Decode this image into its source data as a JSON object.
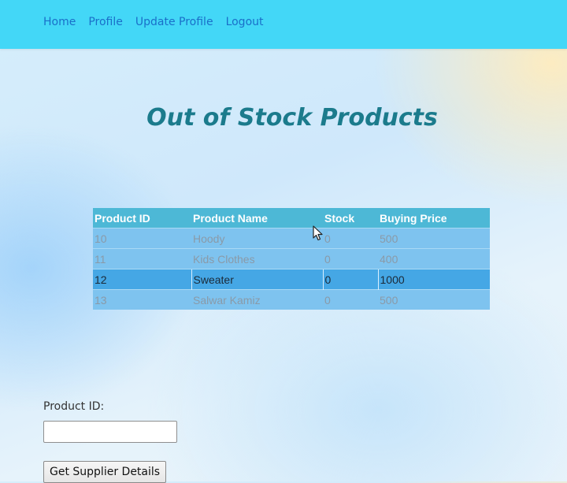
{
  "nav": {
    "links": [
      "Home",
      "Profile",
      "Update Profile",
      "Logout"
    ]
  },
  "page": {
    "title": "Out of Stock Products"
  },
  "table": {
    "headers": [
      "Product ID",
      "Product Name",
      "Stock",
      "Buying Price"
    ],
    "rows": [
      [
        "10",
        "Hoody",
        "0",
        "500"
      ],
      [
        "11",
        "Kids Clothes",
        "0",
        "400"
      ],
      [
        "12",
        "Sweater",
        "0",
        "1000"
      ],
      [
        "13",
        "Salwar Kamiz",
        "0",
        "500"
      ]
    ],
    "selected_row": 2
  },
  "form": {
    "product_id_label": "Product ID:",
    "product_id_value": "",
    "submit_label": "Get Supplier Details"
  },
  "colors": {
    "navbar": "#43d7f7",
    "nav_link": "#1a6fc9",
    "title": "#1b7b8c",
    "table_header": "#4db8d6",
    "table_row": "#7ec3ef",
    "table_row_selected": "#45a7e5"
  },
  "icons": {
    "cursor": "mouse-pointer-icon"
  }
}
